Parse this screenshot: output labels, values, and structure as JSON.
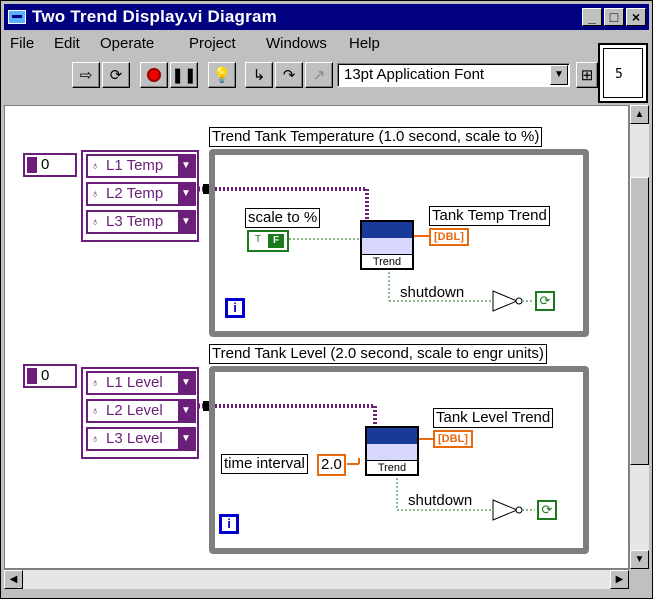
{
  "window": {
    "title": "Two Trend Display.vi Diagram"
  },
  "window_buttons": [
    "_",
    "□",
    "×"
  ],
  "menu": [
    "File",
    "Edit",
    "Operate",
    "Project",
    "Windows",
    "Help"
  ],
  "toolbar": {
    "font": "13pt Application Font"
  },
  "vi_icon": {
    "label": "5"
  },
  "diagram": {
    "loop1": {
      "title": "Trend Tank Temperature (1.0 second, scale to %)",
      "index_value": "0",
      "cluster_items": [
        "L1 Temp",
        "L2 Temp",
        "L3 Temp"
      ],
      "scale_label": "scale to %",
      "bool_value": "F",
      "subvi_name": "Trend",
      "output_label": "Tank Temp Trend",
      "output_type": "DBL",
      "shutdown_label": "shutdown",
      "iteration": "i"
    },
    "loop2": {
      "title": "Trend Tank Level (2.0 second, scale to engr units)",
      "index_value": "0",
      "cluster_items": [
        "L1 Level",
        "L2 Level",
        "L3 Level"
      ],
      "time_label": "time interval",
      "time_value": "2.0",
      "subvi_name": "Trend",
      "output_label": "Tank Level Trend",
      "output_type": "DBL",
      "shutdown_label": "shutdown",
      "iteration": "i"
    }
  }
}
